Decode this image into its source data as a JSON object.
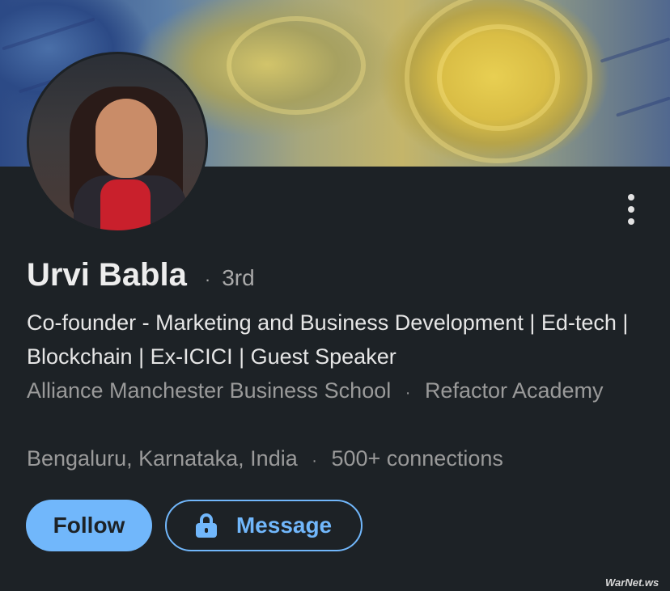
{
  "profile": {
    "name": "Urvi Babla",
    "degree_separator": "·",
    "degree": "3rd",
    "headline": "Co-founder - Marketing and Business Development | Ed-tech | Blockchain | Ex-ICICI | Guest Speaker",
    "education": "Alliance Manchester Business School",
    "meta_separator": "·",
    "company": "Refactor Academy",
    "location": "Bengaluru, Karnataka, India",
    "connections": "500+ connections"
  },
  "actions": {
    "follow_label": "Follow",
    "message_label": "Message",
    "more_icon": "vertical-ellipsis-icon",
    "message_icon": "lock-icon"
  },
  "watermark": {
    "text": "WarNet.ws"
  },
  "colors": {
    "background": "#1d2226",
    "accent": "#71b7fb",
    "primary_text": "#e9e9e9",
    "secondary_text": "#9a9a9a"
  }
}
